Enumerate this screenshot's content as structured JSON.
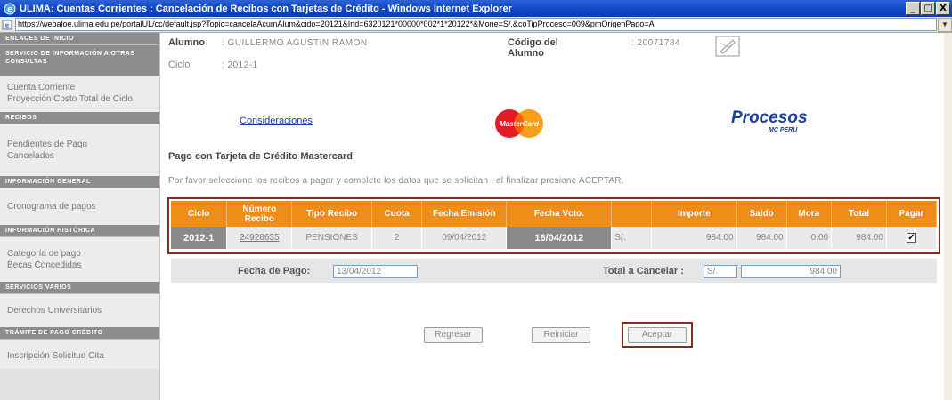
{
  "window": {
    "title": "ULIMA: Cuentas Corrientes : Cancelación de Recibos con Tarjetas de Crédito - Windows Internet Explorer",
    "minimize": "_",
    "maximize": "□",
    "close": "X"
  },
  "address": {
    "url": "https://webaloe.ulima.edu.pe/portalUL/cc/default.jsp?Topic=cancelaAcumAlum&cido=20121&Ind=6320121*00000*002*1*20122*&Mone=S/.&coTipProceso=009&pmOrigenPago=A"
  },
  "sidebar": {
    "groups": [
      {
        "header": "ENLACES DE INICIO",
        "items": []
      },
      {
        "header": "SERVICIO DE INFORMACIÓN A OTRAS CONSULTAS",
        "items": [
          "Cuenta Corriente",
          "Proyección Costo Total de Ciclo"
        ]
      },
      {
        "header": "RECIBOS",
        "items": [
          "Pendientes de Pago",
          "Cancelados"
        ]
      },
      {
        "header": "INFORMACIÓN GENERAL",
        "items": [
          "Cronograma de pagos"
        ]
      },
      {
        "header": "INFORMACIÓN HISTÓRICA",
        "items": [
          "Categoría de pago",
          "Becas Concedidas"
        ]
      },
      {
        "header": "SERVICIOS VARIOS",
        "items": [
          "Derechos Universitarios"
        ]
      },
      {
        "header": "TRÁMITE DE PAGO CRÉDITO",
        "items": [
          "Inscripción Solicitud Cita"
        ]
      }
    ]
  },
  "student": {
    "name_label": "Alumno",
    "name_value": ": GUILLERMO AGUSTIN RAMON",
    "code_label": "Código del Alumno",
    "code_value": ": 20071784",
    "cycle_label": "Ciclo",
    "cycle_value": ": 2012-1"
  },
  "links": {
    "considerations": "Consideraciones"
  },
  "logos": {
    "mastercard": "MasterCard",
    "procesos": "Procesos",
    "procesos_sub": "MC PERU"
  },
  "payment": {
    "section_title": "Pago con Tarjeta de Crédito Mastercard",
    "instructions": "Por favor seleccione los recibos a pagar y complete los datos que se solicitan , al finalizar presione ACEPTAR.",
    "columns": [
      "Ciclo",
      "Número Recibo",
      "Tipo Recibo",
      "Cuota",
      "Fecha Emisión",
      "Fecha Vcto.",
      "",
      "Importe",
      "Saldo",
      "Mora",
      "Total",
      "Pagar"
    ],
    "rows": [
      {
        "ciclo": "2012-1",
        "numero": "24928635",
        "tipo": "PENSIONES",
        "cuota": "2",
        "emision": "09/04/2012",
        "vencimiento": "16/04/2012",
        "moneda": "S/.",
        "importe": "984.00",
        "saldo": "984.00",
        "mora": "0.00",
        "total": "984.00",
        "pagar": "☑"
      }
    ],
    "fecha_pago_label": "Fecha de Pago:",
    "fecha_pago_value": "13/04/2012",
    "total_label": "Total a Cancelar :",
    "total_currency": "S/.",
    "total_value": "984.00"
  },
  "buttons": {
    "back": "Regresar",
    "reset": "Reiniciar",
    "accept": "Aceptar"
  },
  "colors": {
    "header_orange": "#f08c1a",
    "highlight_frame": "#8b2a1f",
    "link_blue": "#1a3fa0"
  }
}
